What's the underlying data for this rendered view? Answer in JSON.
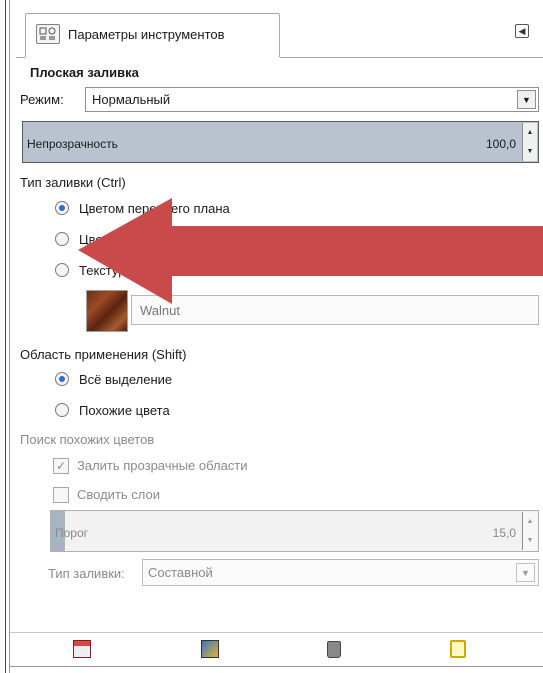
{
  "tab": {
    "icon": "tool-options-icon",
    "label": "Параметры инструментов",
    "menu_icon": "tab-menu-icon"
  },
  "tool": {
    "title": "Плоская заливка",
    "mode_label": "Режим:",
    "mode_value": "Нормальный",
    "opacity_label": "Непрозрачность",
    "opacity_value": "100,0"
  },
  "fill_type": {
    "heading": "Тип заливки (Ctrl)",
    "options": [
      {
        "label": "Цветом переднего плана",
        "checked": true
      },
      {
        "label": "Цве",
        "checked": false
      },
      {
        "label": "Текстуро",
        "checked": false
      }
    ],
    "pattern_name": "Walnut"
  },
  "affected_area": {
    "heading": "Область применения (Shift)",
    "options": [
      {
        "label": "Всё выделение",
        "checked": true
      },
      {
        "label": "Похожие цвета",
        "checked": false
      }
    ]
  },
  "similar_colors": {
    "heading": "Поиск похожих цветов",
    "fill_transparent": {
      "label": "Залить прозрачные области",
      "checked": true
    },
    "sample_merged": {
      "label": "Сводить слои",
      "checked": false
    },
    "threshold_label": "Порог",
    "threshold_value": "15,0",
    "fill_by_label": "Тип заливки:",
    "fill_by_value": "Составной"
  },
  "bottom_icons": [
    "save-preset-icon",
    "restore-preset-icon",
    "delete-preset-icon",
    "reset-icon"
  ],
  "colors": {
    "accent_blue": "#2a6bd8",
    "slider_fill": "#b8c3cf",
    "annotation_arrow": "#c94a4a"
  }
}
